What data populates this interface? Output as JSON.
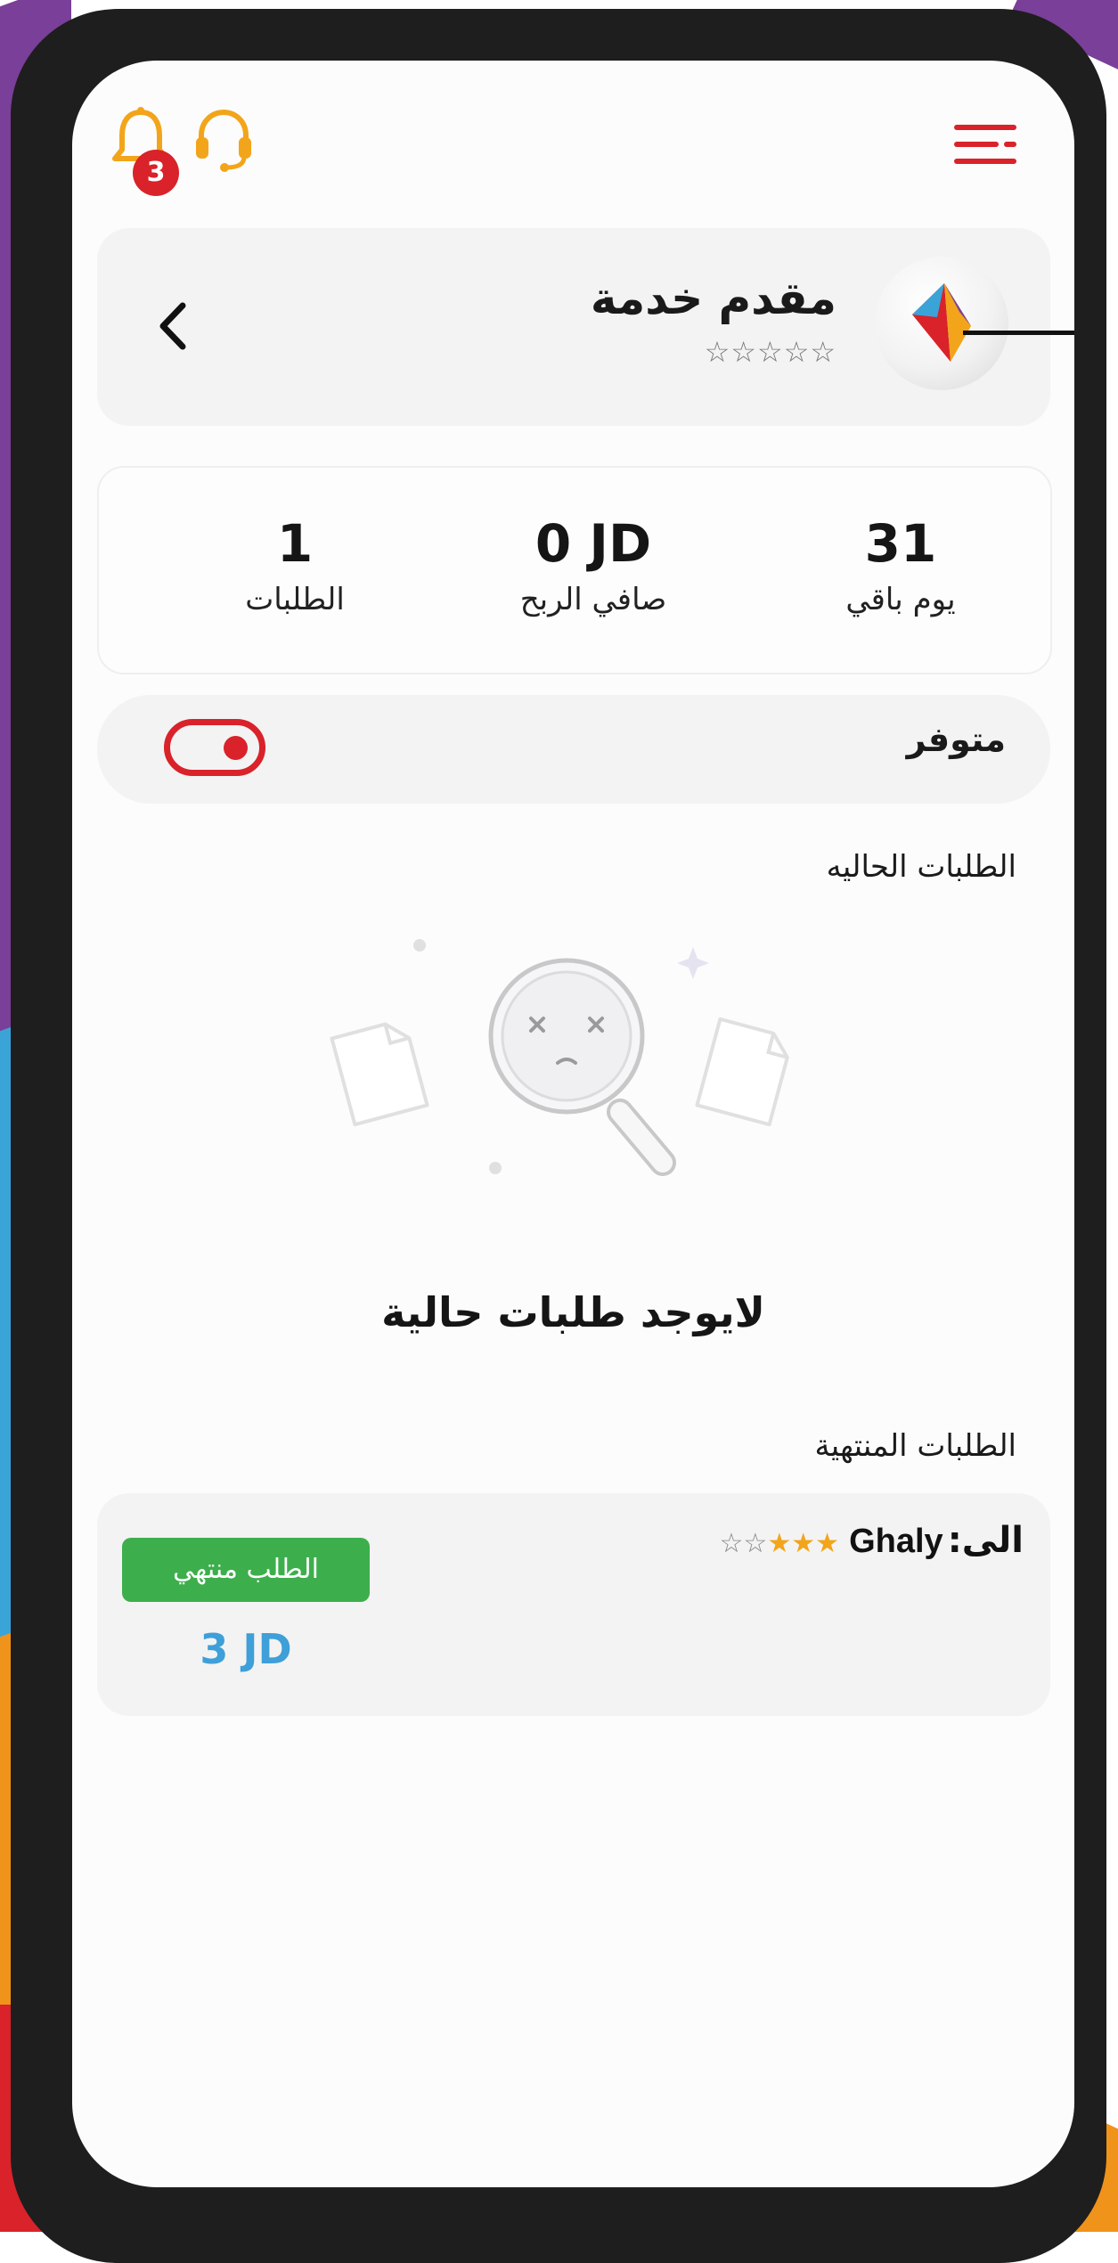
{
  "header": {
    "menu_icon": "hamburger-menu-icon",
    "notification_icon": "bell-icon",
    "notification_count": "3",
    "support_icon": "headset-icon",
    "accent_color": "#d9222a",
    "icon_color": "#f2a51a"
  },
  "profile": {
    "name": "مقدم خدمة",
    "rating_stars": "☆☆☆☆☆",
    "rating": 0,
    "back_icon": "chevron-left-icon",
    "logo": "diamond-logo"
  },
  "stats": [
    {
      "value": "31",
      "label": "يوم باقي"
    },
    {
      "value": "0 JD",
      "label": "صافي الربح"
    },
    {
      "value": "1",
      "label": "الطلبات"
    }
  ],
  "availability": {
    "label": "متوفر",
    "enabled": true
  },
  "current_orders": {
    "title": "الطلبات الحاليه",
    "empty_text": "لايوجد طلبات حالية",
    "empty_icon": "magnifier-sad-icon"
  },
  "finished_orders": {
    "title": "الطلبات المنتهية",
    "items": [
      {
        "to_label": "الى:",
        "name": "Ghaly",
        "stars_filled": "★★★",
        "stars_empty": "☆☆",
        "rating": 3,
        "status": "الطلب منتهي",
        "price": "3 JD",
        "status_color": "#3dae4c",
        "price_color": "#3f9fd8"
      }
    ]
  }
}
